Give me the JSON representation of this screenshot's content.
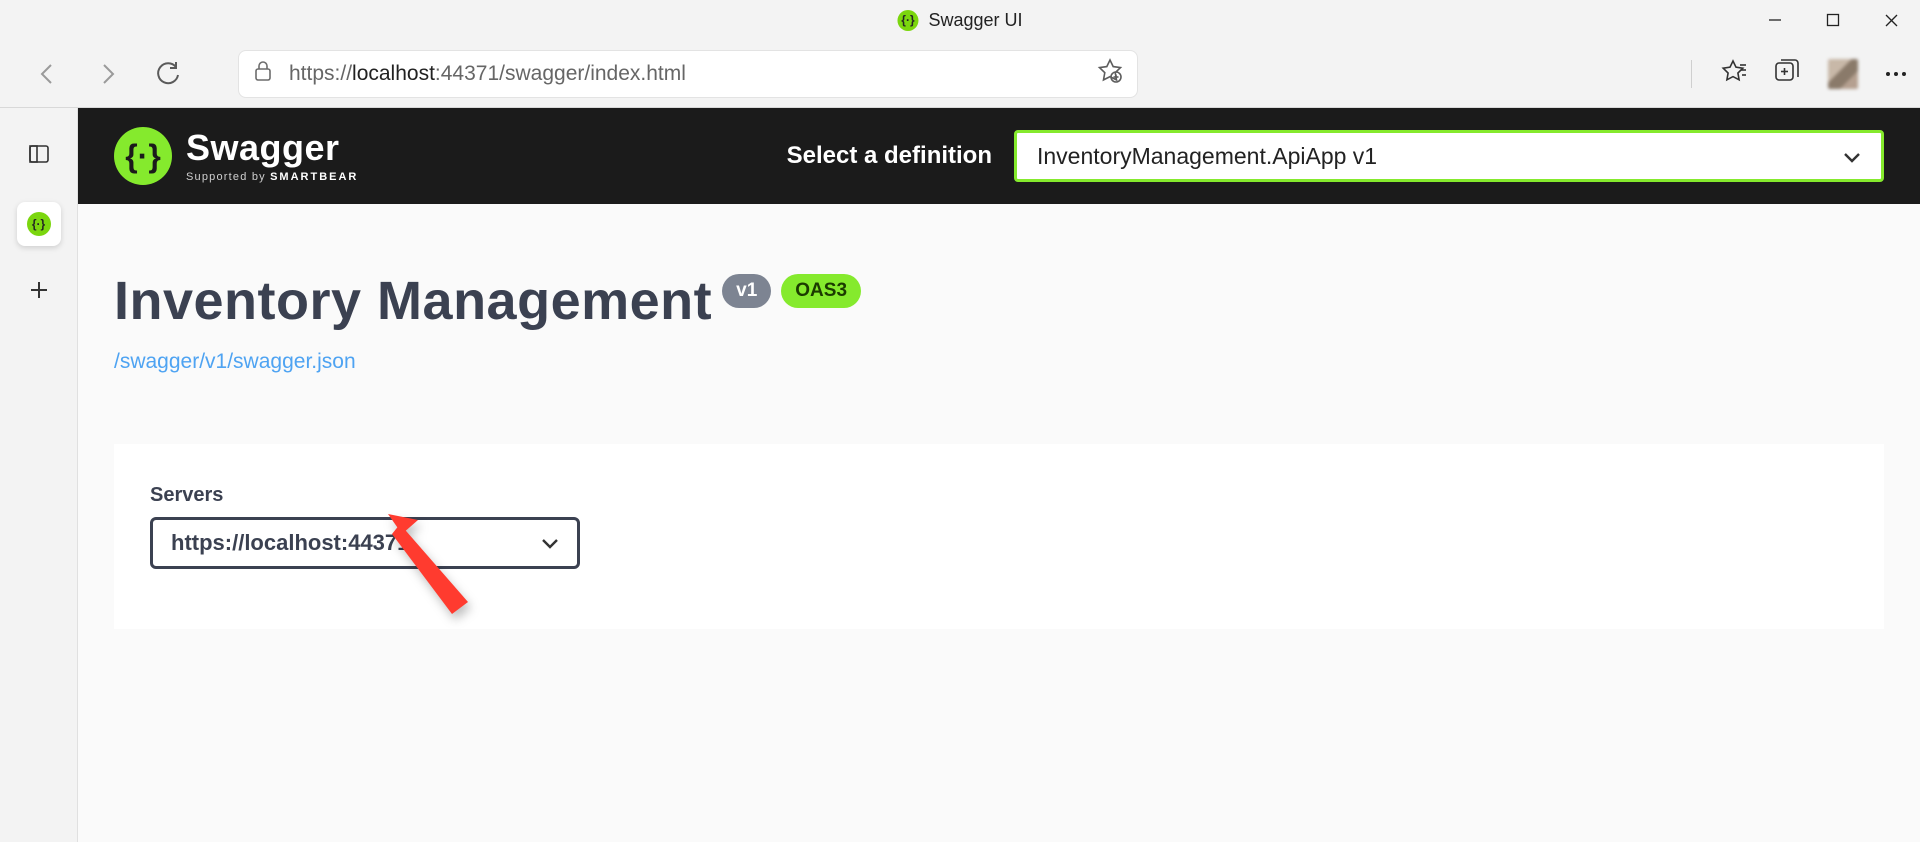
{
  "window": {
    "title": "Swagger UI"
  },
  "address": {
    "scheme": "https://",
    "host": "localhost",
    "rest": ":44371/swagger/index.html"
  },
  "swagger": {
    "brand": "Swagger",
    "supported_prefix": "Supported by ",
    "supported_brand": "SMARTBEAR",
    "select_label": "Select a definition",
    "definition": "InventoryManagement.ApiApp v1",
    "title": "Inventory Management",
    "version_pill": "v1",
    "oas_pill": "OAS3",
    "spec_link": "/swagger/v1/swagger.json",
    "servers_label": "Servers",
    "server": "https://localhost:44371"
  }
}
